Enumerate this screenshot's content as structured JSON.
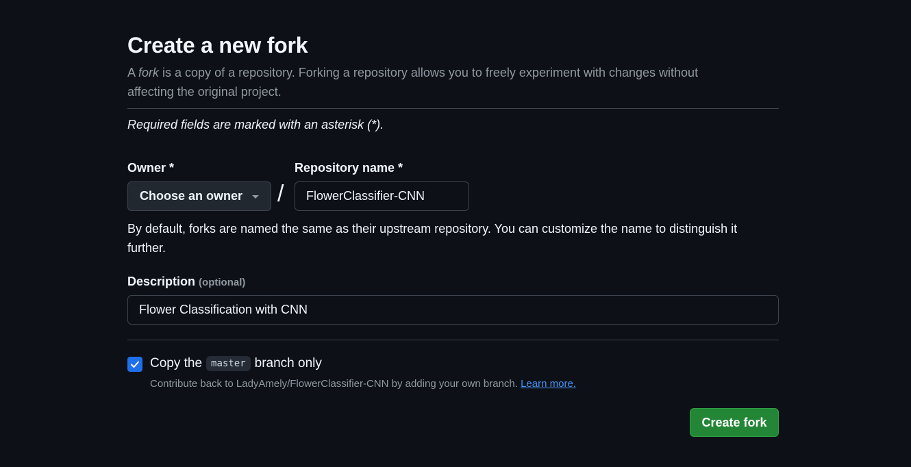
{
  "header": {
    "title": "Create a new fork",
    "subtitle_prefix": "A ",
    "subtitle_em": "fork",
    "subtitle_suffix": " is a copy of a repository. Forking a repository allows you to freely experiment with changes without affecting the original project."
  },
  "required_note": "Required fields are marked with an asterisk (*).",
  "owner": {
    "label": "Owner *",
    "selected": "Choose an owner"
  },
  "separator": "/",
  "repository": {
    "label": "Repository name *",
    "value": "FlowerClassifier-CNN"
  },
  "name_help": "By default, forks are named the same as their upstream repository. You can customize the name to distinguish it further.",
  "description": {
    "label": "Description",
    "optional": "(optional)",
    "value": "Flower Classification with CNN"
  },
  "copy_branch": {
    "checked": true,
    "label_prefix": "Copy the",
    "branch": "master",
    "label_suffix": "branch only",
    "help_text": "Contribute back to LadyAmely/FlowerClassifier-CNN by adding your own branch.",
    "learn_more": "Learn more."
  },
  "submit": {
    "label": "Create fork"
  },
  "colors": {
    "background": "#0d1117",
    "primary_button": "#238636",
    "checkbox": "#1f6feb",
    "link": "#4493f8"
  }
}
